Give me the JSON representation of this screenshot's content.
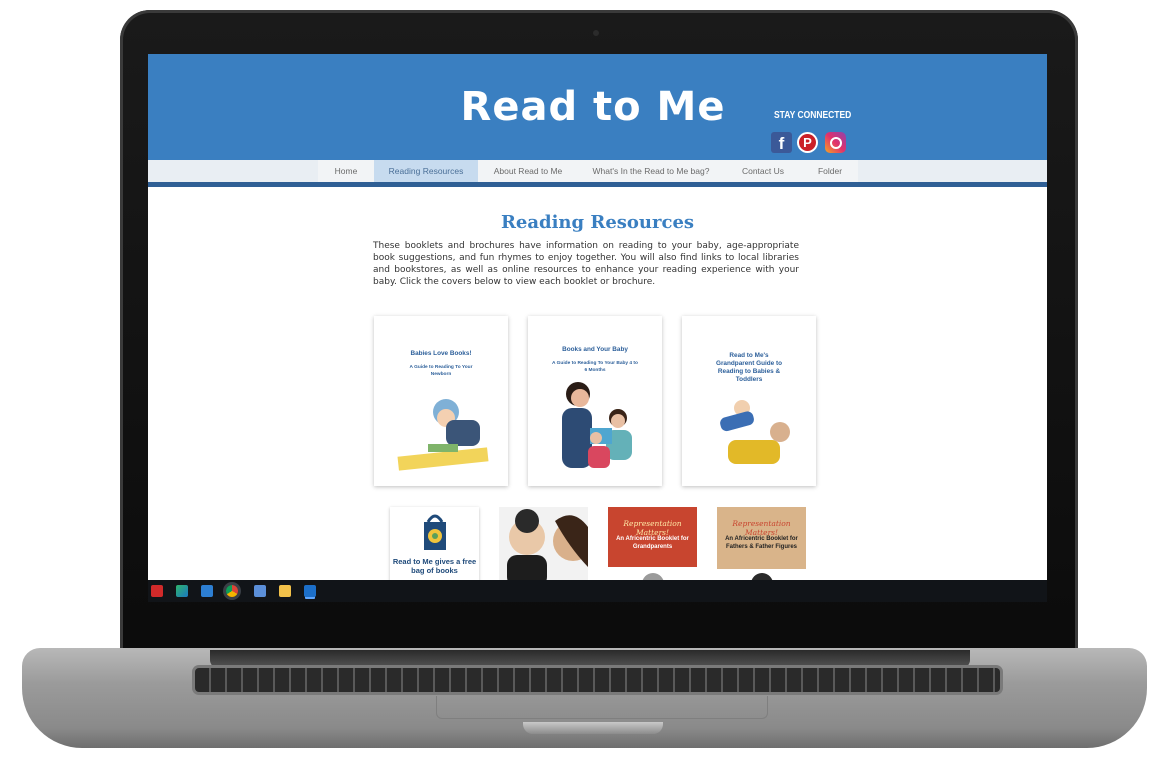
{
  "site": {
    "title": "Read to Me",
    "stay_connected": "STAY CONNECTED"
  },
  "social": {
    "facebook_glyph": "f",
    "pinterest_glyph": "P"
  },
  "nav": {
    "items": [
      "Home",
      "Reading Resources",
      "About Read to Me",
      "What's In the Read to Me bag?",
      "Contact Us",
      "Folder"
    ],
    "active": "Reading Resources"
  },
  "page": {
    "heading": "Reading Resources",
    "intro": "These booklets and brochures have information on reading to your baby, age-appropriate book suggestions, and fun rhymes to enjoy together. You will also find links to local libraries and bookstores, as well as online resources to enhance your reading experience with your baby. Click the covers below to view each booklet or brochure."
  },
  "cards": [
    {
      "title": "Babies Love Books!",
      "subtitle": "A Guide to Reading To Your Newborn"
    },
    {
      "title": "Books and Your Baby",
      "subtitle": "A Guide to Reading To Your Baby 4 to 6 Months"
    },
    {
      "title": "Read to Me's Grandparent Guide to Reading to Babies & Toddlers",
      "subtitle": ""
    }
  ],
  "row2": [
    {
      "text": "Read to Me gives a free bag of books"
    },
    {
      "text": ""
    },
    {
      "rep": "Representation Matters!",
      "text": "An Africentric Booklet for Grandparents"
    },
    {
      "rep": "Representation Matters!",
      "text": "An Africentric Booklet for Fathers & Father Figures"
    }
  ],
  "colors": {
    "header": "#3a7fc1",
    "nav_rule": "#2f5f95",
    "heading": "#3a7fc1"
  }
}
